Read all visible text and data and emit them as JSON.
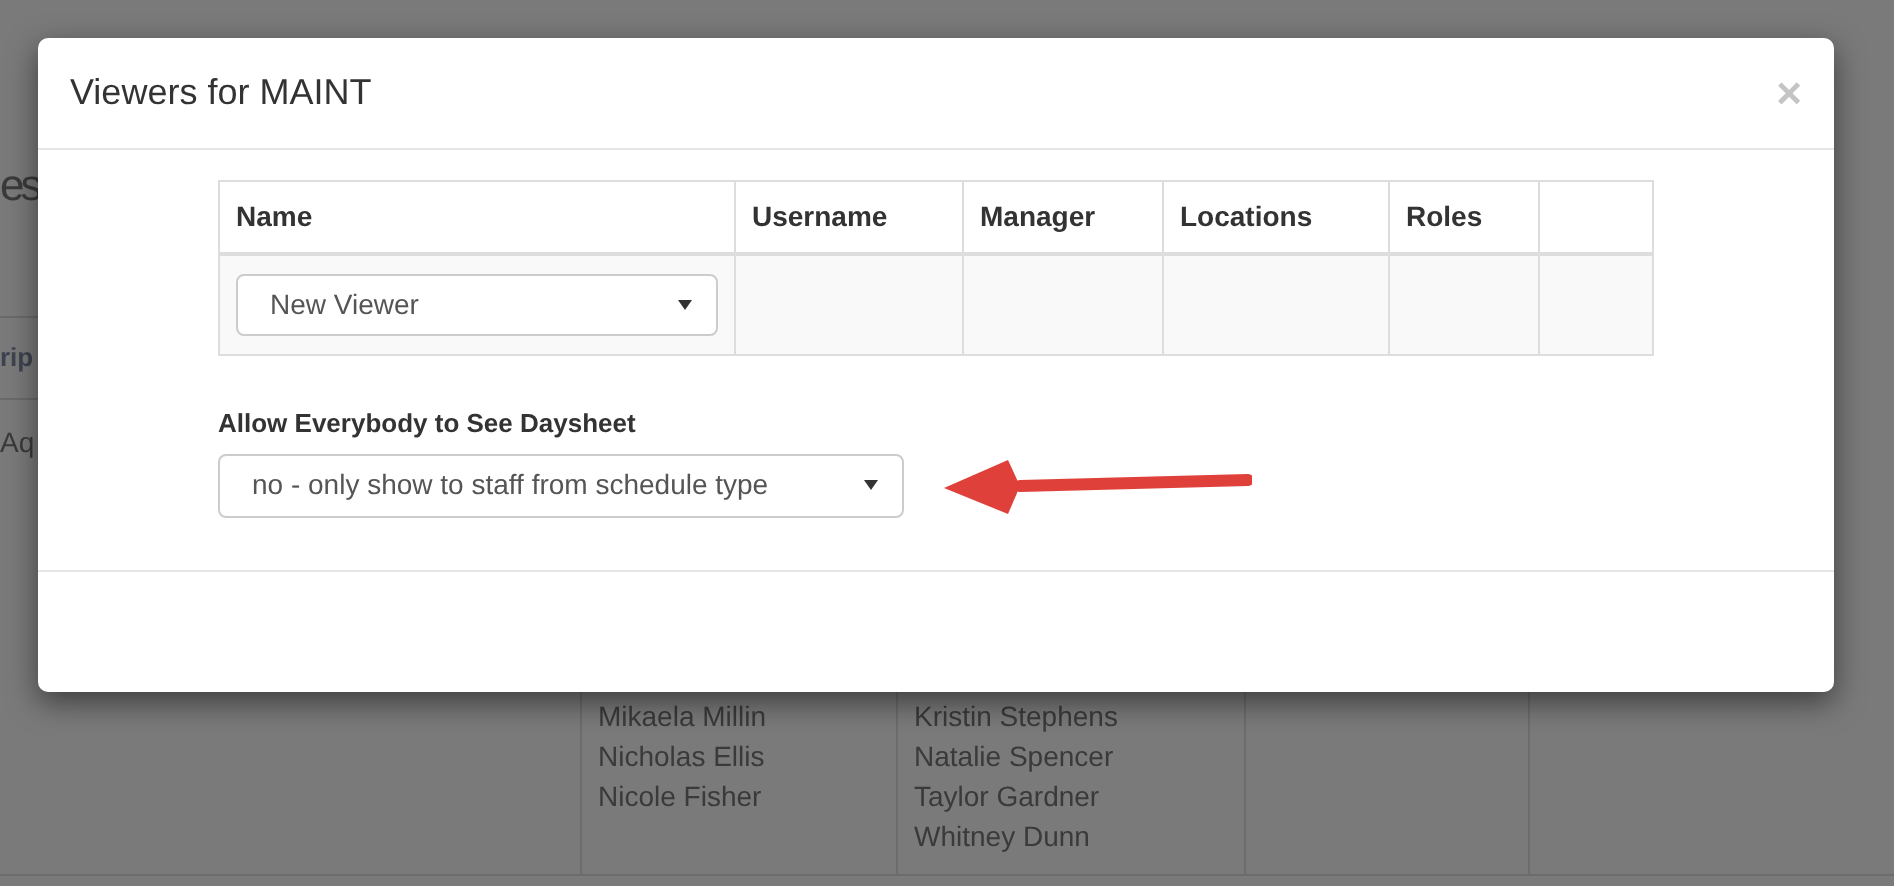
{
  "background": {
    "title": "es",
    "column_header": "rip",
    "cell": "Aq",
    "name_columns": [
      [
        "Mikaela Millin",
        "Nicholas Ellis",
        "Nicole Fisher"
      ],
      [
        "Kristin Stephens",
        "Natalie Spencer",
        "Taylor Gardner",
        "Whitney Dunn"
      ]
    ]
  },
  "modal": {
    "title": "Viewers for MAINT",
    "close": "×",
    "table": {
      "columns": [
        "Name",
        "Username",
        "Manager",
        "Locations",
        "Roles"
      ],
      "new_row": {
        "name_select": "New Viewer"
      }
    },
    "setting": {
      "label": "Allow Everybody to See Daysheet",
      "value": "no - only show to staff from schedule type"
    }
  }
}
